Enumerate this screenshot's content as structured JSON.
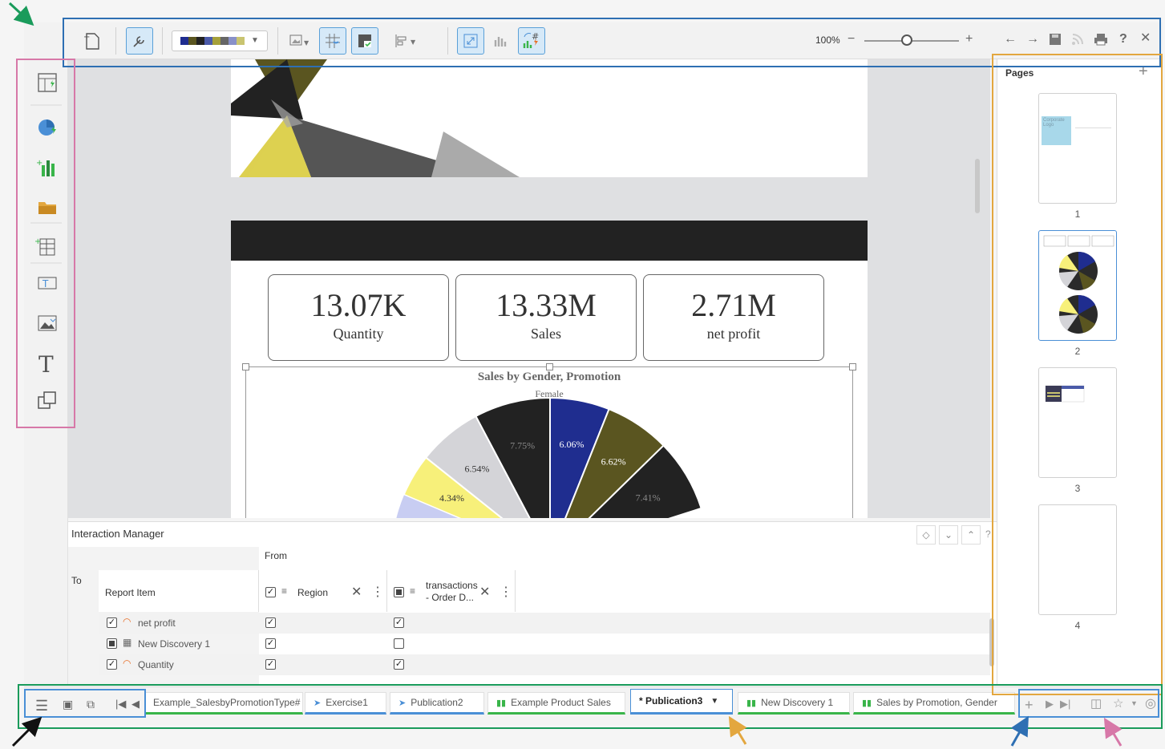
{
  "toolbar": {
    "zoom": "100%",
    "zoom_minus": "−",
    "zoom_plus": "+"
  },
  "canvas": {
    "kpis": [
      {
        "value": "13.07K",
        "label": "Quantity"
      },
      {
        "value": "13.33M",
        "label": "Sales"
      },
      {
        "value": "2.71M",
        "label": "net profit"
      }
    ],
    "chart_data": {
      "type": "pie",
      "title": "Sales by Gender, Promotion",
      "subtitle": "Female",
      "slices": [
        {
          "label": "7.75%",
          "value": 7.75,
          "color": "#222222"
        },
        {
          "label": "6.06%",
          "value": 6.06,
          "color": "#1f2d8f"
        },
        {
          "label": "6.62%",
          "value": 6.62,
          "color": "#5a5520"
        },
        {
          "label": "7.41%",
          "value": 7.41,
          "color": "#222222"
        },
        {
          "label": "6.54%",
          "value": 6.54,
          "color": "#d4d4d8"
        },
        {
          "label": "4.34%",
          "value": 4.34,
          "color": "#f7f07a"
        }
      ]
    }
  },
  "pages_panel": {
    "title": "Pages",
    "add": "+",
    "thumb1_text": "Corporate Logo",
    "pages": [
      "1",
      "2",
      "3",
      "4"
    ]
  },
  "interaction_manager": {
    "title": "Interaction Manager",
    "to_label": "To",
    "from_label": "From",
    "col_report_item": "Report Item",
    "col_region": "Region",
    "col_transactions": "transactions - Order D...",
    "rows": [
      {
        "name": "net profit",
        "region": true,
        "transactions": true
      },
      {
        "name": "New Discovery 1",
        "region": true,
        "transactions": false
      },
      {
        "name": "Quantity",
        "region": true,
        "transactions": true
      }
    ]
  },
  "tabs": [
    {
      "label": "Example_SalesbyPromotionType#",
      "color": "green",
      "icon": ""
    },
    {
      "label": "Exercise1",
      "color": "blue",
      "icon": "publication"
    },
    {
      "label": "Publication2",
      "color": "blue",
      "icon": "publication"
    },
    {
      "label": "Example Product Sales",
      "color": "green",
      "icon": "chart"
    },
    {
      "label": "* Publication3",
      "color": "blue",
      "icon": "publication",
      "active": true
    },
    {
      "label": "New Discovery 1",
      "color": "green",
      "icon": "chart"
    },
    {
      "label": "Sales by Promotion, Gender",
      "color": "green",
      "icon": "chart"
    }
  ],
  "colors": {
    "annot_green": "#1a9b5b",
    "annot_blue": "#2e6fb3",
    "annot_pink": "#d778a8",
    "annot_orange": "#e3a73f",
    "annot_black": "#111111"
  }
}
